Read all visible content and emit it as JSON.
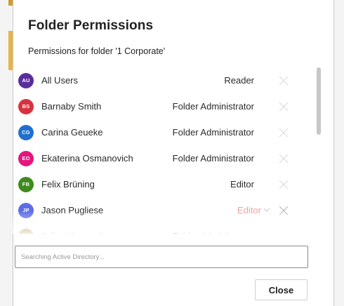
{
  "dialog": {
    "title": "Folder Permissions",
    "subtitle": "Permissions for folder '1 Corporate'",
    "search": {
      "placeholder": "Searching Active Directory...",
      "value": ""
    },
    "close_label": "Close"
  },
  "users": [
    {
      "initials": "AU",
      "name": "All Users",
      "role": "Reader",
      "color": "#5a2d9c",
      "editing": false
    },
    {
      "initials": "BS",
      "name": "Barnaby Smith",
      "role": "Folder Administrator",
      "color": "#d6333f",
      "editing": false
    },
    {
      "initials": "CG",
      "name": "Carina Geueke",
      "role": "Folder Administrator",
      "color": "#1f6fd1",
      "editing": false
    },
    {
      "initials": "EO",
      "name": "Ekaterina Osmanovich",
      "role": "Folder Administrator",
      "color": "#e5157d",
      "editing": false
    },
    {
      "initials": "FB",
      "name": "Felix Brüning",
      "role": "Editor",
      "color": "#3f8a1e",
      "editing": false
    },
    {
      "initials": "JP",
      "name": "Jason Pugliese",
      "role": "Editor",
      "color": "#5c6ce6",
      "editing": true
    },
    {
      "initials": "JK",
      "name": "Julian Kornmaier",
      "role": "Folder Administrator",
      "color": "#b5842a",
      "editing": false
    }
  ],
  "icons": {
    "remove": "close-icon",
    "dropdown": "chevron-down-icon"
  }
}
